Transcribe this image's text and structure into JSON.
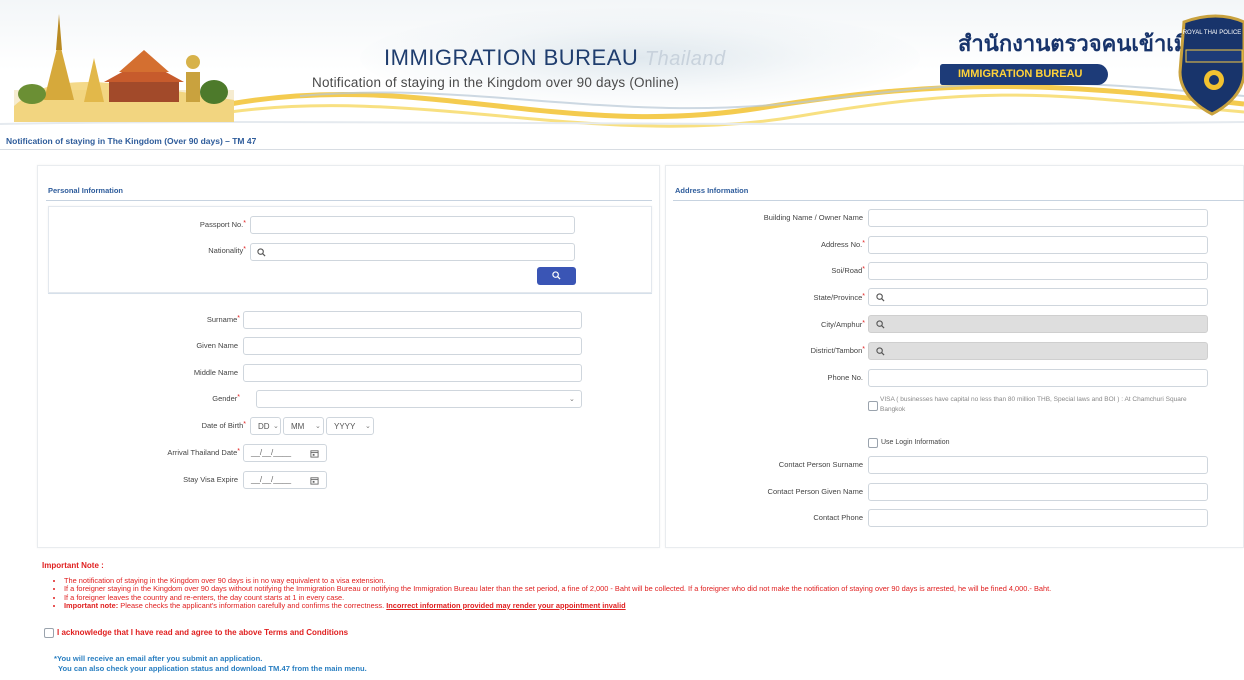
{
  "header": {
    "title_main": "IMMIGRATION BUREAU",
    "title_country": "Thailand",
    "subtitle": "Notification of staying in the Kingdom over 90 days (Online)",
    "thai_title": "สำนักงานตรวจคนเข้าเมือง",
    "badge": "IMMIGRATION BUREAU",
    "seal_text": "ROYAL THAI POLICE"
  },
  "breadcrumb": "Notification of staying in The Kingdom (Over 90 days) – TM 47",
  "personal": {
    "title": "Personal Information",
    "passport_label": "Passport No.",
    "nationality_label": "Nationality",
    "surname_label": "Surname",
    "given_label": "Given Name",
    "middle_label": "Middle Name",
    "gender_label": "Gender",
    "dob_label": "Date of Birth",
    "dob_day": "DD",
    "dob_month": "MM",
    "dob_year": "YYYY",
    "arrival_label": "Arrival Thailand Date",
    "arrival_placeholder": "__/__/____",
    "stay_label": "Stay Visa Expire",
    "stay_placeholder": "__/__/____"
  },
  "address": {
    "title": "Address Information",
    "building_label": "Building Name / Owner Name",
    "address_no_label": "Address No.",
    "soi_label": "Soi/Road",
    "state_label": "State/Province",
    "city_label": "City/Amphur",
    "district_label": "District/Tambon",
    "phone_label": "Phone No.",
    "visa_note": "VISA ( businesses have capital no less than 80 million THB, Special laws and BOI ) : At Chamchuri Square Bangkok",
    "use_login_label": "Use Login Information",
    "contact_surname_label": "Contact Person Surname",
    "contact_given_label": "Contact Person Given Name",
    "contact_phone_label": "Contact Phone"
  },
  "important": {
    "title": "Important Note :",
    "notes": [
      "The notification of staying in the Kingdom over 90 days is in no way equivalent to a visa extension.",
      "If a foreigner staying in the Kingdom over 90 days without notifying the Immigration Bureau or notifying the Immigration Bureau later than the set period, a fine of 2,000 - Baht will be collected. If a foreigner who did not make the notification of staying over 90 days is arrested, he will be fined 4,000.- Baht.",
      "If a foreigner leaves the country and re-enters, the day count starts at 1 in every case."
    ],
    "note4_bold": "Important note:",
    "note4_text": "Please checks the applicant's information carefully and confirms the correctness.",
    "note4_underline": "Incorrect information provided may render your appointment invalid",
    "ack": "I acknowledge that I have read and agree to the above Terms and Conditions",
    "email_line1": "*You will receive an email after you submit an application.",
    "email_line2": "You can also check your application status and download TM.47 from the main menu."
  },
  "colors": {
    "accent": "#2e5c9b",
    "required": "#e02020",
    "button": "#3a55b5",
    "link_info": "#2a7fc1"
  },
  "icons": [
    "search-icon",
    "calendar-icon",
    "chevron-down-icon",
    "checkbox-icon"
  ]
}
